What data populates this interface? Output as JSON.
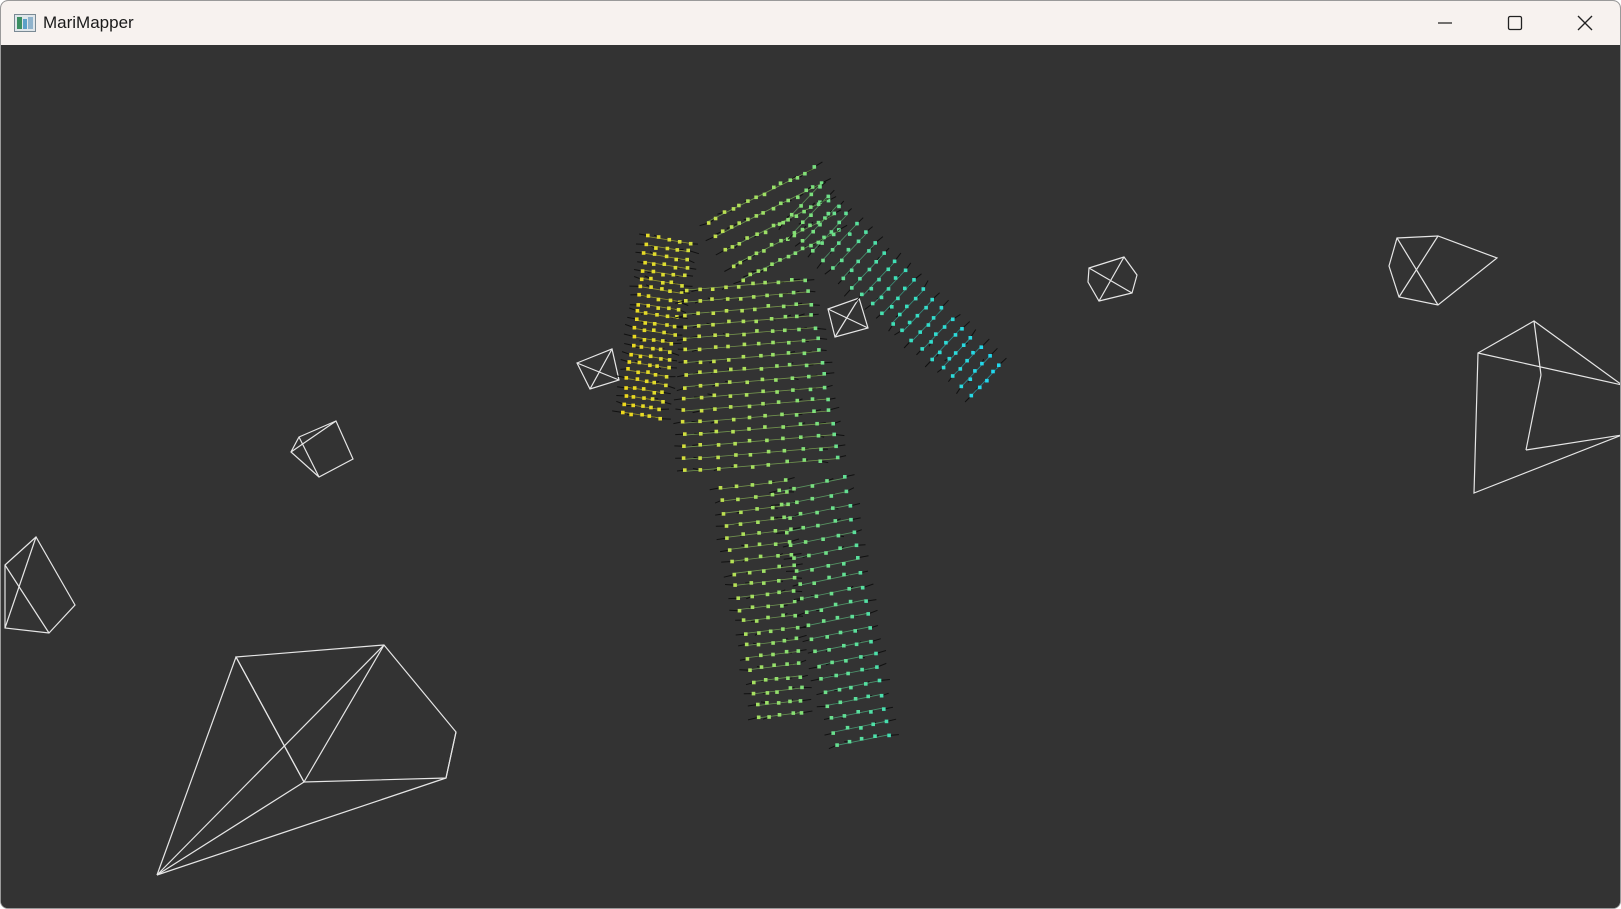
{
  "window": {
    "title": "MariMapper",
    "icon": "marimapper-app-icon",
    "controls": [
      "minimize-icon",
      "maximize-icon",
      "close-icon"
    ]
  },
  "scene": {
    "background": "#333333",
    "camera_frustum_color": "#e6e6e6",
    "led_color_gradient": [
      "#f0d81a",
      "#c8e04a",
      "#7fe07a",
      "#3fe0b8",
      "#22d8ee"
    ],
    "normal_line_color": "#111111"
  }
}
